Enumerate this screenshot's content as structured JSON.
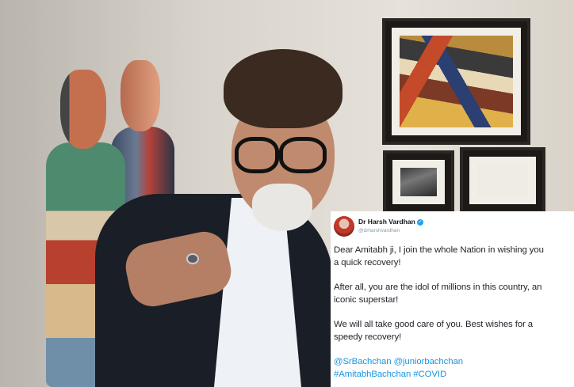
{
  "tweet": {
    "display_name": "Dr Harsh Vardhan",
    "handle": "@drharshvardhan",
    "paragraphs": [
      [
        "Dear Amitabh ji, I join the whole Nation in wishing you",
        "a quick recovery!"
      ],
      [
        "After all, you are the idol of millions in this country, an",
        "iconic superstar!"
      ],
      [
        "We will all take good care of you. Best wishes for a",
        "speedy recovery!"
      ]
    ],
    "mentions": [
      "@SrBachchan",
      "@juniorbachchan"
    ],
    "hashtags": [
      "#AmitabhBachchan",
      "#COVID"
    ],
    "colors": {
      "link": "#1b95e0",
      "verified": "#1da1f2"
    }
  }
}
